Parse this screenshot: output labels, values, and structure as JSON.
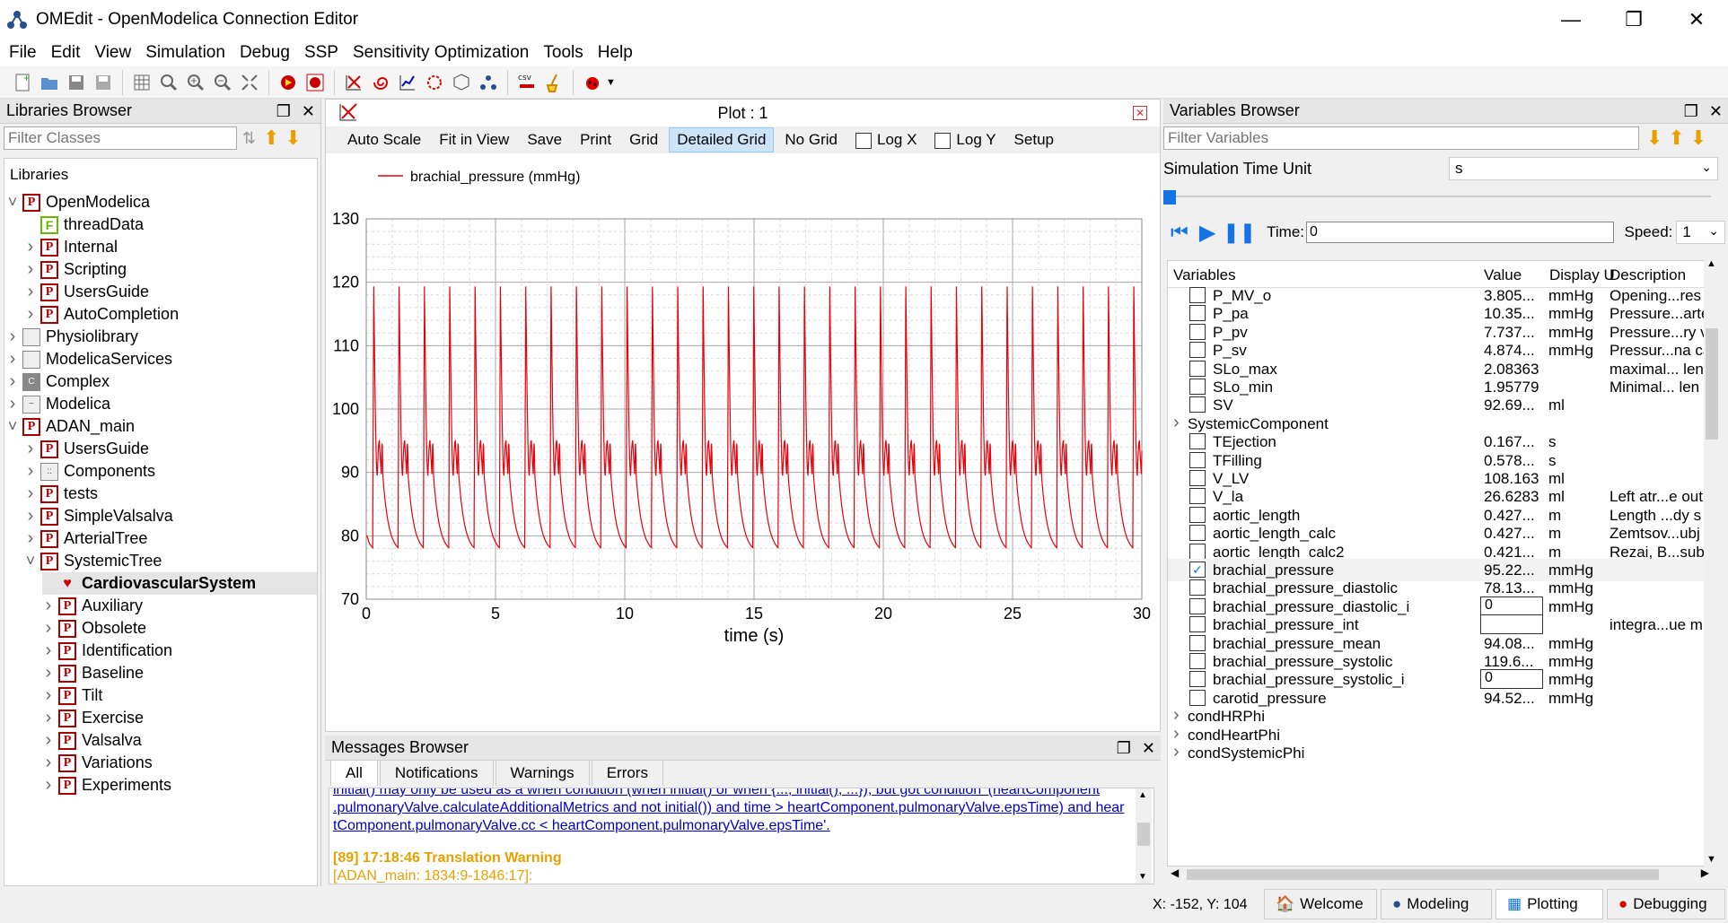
{
  "window": {
    "title": "OMEdit - OpenModelica Connection Editor"
  },
  "menu": [
    "File",
    "Edit",
    "View",
    "Simulation",
    "Debug",
    "SSP",
    "Sensitivity Optimization",
    "Tools",
    "Help"
  ],
  "libraries": {
    "title": "Libraries Browser",
    "filter_placeholder": "Filter Classes",
    "tree_title": "Libraries",
    "items": [
      {
        "label": "OpenModelica",
        "icon": "P",
        "level": 0,
        "expanded": true
      },
      {
        "label": "threadData",
        "icon": "F",
        "level": 1,
        "expanded": null
      },
      {
        "label": "Internal",
        "icon": "P",
        "level": 1,
        "expanded": false
      },
      {
        "label": "Scripting",
        "icon": "P",
        "level": 1,
        "expanded": false
      },
      {
        "label": "UsersGuide",
        "icon": "P",
        "level": 1,
        "expanded": false
      },
      {
        "label": "AutoCompletion",
        "icon": "P",
        "level": 1,
        "expanded": false
      },
      {
        "label": "Physiolibrary",
        "icon": "plain",
        "level": 0,
        "expanded": false
      },
      {
        "label": "ModelicaServices",
        "icon": "plain",
        "level": 0,
        "expanded": false
      },
      {
        "label": "Complex",
        "icon": "C",
        "level": 0,
        "expanded": false
      },
      {
        "label": "Modelica",
        "icon": "M",
        "level": 0,
        "expanded": false
      },
      {
        "label": "ADAN_main",
        "icon": "P",
        "level": 0,
        "expanded": true
      },
      {
        "label": "UsersGuide",
        "icon": "P",
        "level": 1,
        "expanded": false
      },
      {
        "label": "Components",
        "icon": "comp",
        "level": 1,
        "expanded": false
      },
      {
        "label": "tests",
        "icon": "P",
        "level": 1,
        "expanded": false
      },
      {
        "label": "SimpleValsalva",
        "icon": "P",
        "level": 1,
        "expanded": false
      },
      {
        "label": "ArterialTree",
        "icon": "P",
        "level": 1,
        "expanded": false
      },
      {
        "label": "SystemicTree",
        "icon": "P",
        "level": 1,
        "expanded": true
      },
      {
        "label": "CardiovascularSystem",
        "icon": "model",
        "level": 2,
        "expanded": null,
        "selected": true
      },
      {
        "label": "Auxiliary",
        "icon": "P",
        "level": 2,
        "expanded": false
      },
      {
        "label": "Obsolete",
        "icon": "P",
        "level": 2,
        "expanded": false
      },
      {
        "label": "Identification",
        "icon": "P",
        "level": 2,
        "expanded": false
      },
      {
        "label": "Baseline",
        "icon": "P",
        "level": 2,
        "expanded": false
      },
      {
        "label": "Tilt",
        "icon": "P",
        "level": 2,
        "expanded": false
      },
      {
        "label": "Exercise",
        "icon": "P",
        "level": 2,
        "expanded": false
      },
      {
        "label": "Valsalva",
        "icon": "P",
        "level": 2,
        "expanded": false
      },
      {
        "label": "Variations",
        "icon": "P",
        "level": 2,
        "expanded": false
      },
      {
        "label": "Experiments",
        "icon": "P",
        "level": 2,
        "expanded": false
      }
    ]
  },
  "plot": {
    "title": "Plot : 1",
    "buttons": [
      "Auto Scale",
      "Fit in View",
      "Save",
      "Print",
      "Grid",
      "Detailed Grid",
      "No Grid"
    ],
    "active_button": "Detailed Grid",
    "log_x": "Log X",
    "log_y": "Log Y",
    "setup": "Setup"
  },
  "chart_data": {
    "type": "line",
    "legend": "brachial_pressure (mmHg)",
    "xlabel": "time (s)",
    "ylabel": "",
    "xlim": [
      0,
      30
    ],
    "ylim": [
      70,
      130
    ],
    "x_ticks": [
      "0",
      "5",
      "10",
      "15",
      "20",
      "25",
      "30"
    ],
    "y_ticks": [
      "70",
      "80",
      "90",
      "100",
      "110",
      "120",
      "130"
    ],
    "series": [
      {
        "name": "brachial_pressure (mmHg)",
        "color": "#e8000b",
        "description": "periodic pulse wave, ~1.05 Hz",
        "period": 0.98,
        "peak": 119.6,
        "trough": 78.13,
        "dicrotic_notch": 89.5,
        "dicrotic_peak": 95.0,
        "start_value": 80.0
      }
    ],
    "grid": "detailed"
  },
  "messages": {
    "title": "Messages Browser",
    "tabs": [
      "All",
      "Notifications",
      "Warnings",
      "Errors"
    ],
    "lines": [
      "initial() may only be used as a when condition (when initial() or when {..., initial(), ...}), but got condition '(heartComponent",
      ".pulmonaryValve.calculateAdditionalMetrics and not initial()) and time > heartComponent.pulmonaryValve.epsTime) and hear",
      "tComponent.pulmonaryValve.cc < heartComponent.pulmonaryValve.epsTime'."
    ],
    "warning_title": "[89] 17:18:46 Translation Warning",
    "warning_sub": "[ADAN_main: 1834:9-1846:17]:"
  },
  "variables": {
    "title": "Variables Browser",
    "filter_placeholder": "Filter Variables",
    "sim_time_unit_label": "Simulation Time Unit",
    "sim_time_unit": "s",
    "time_label": "Time:",
    "time_value": "0",
    "speed_label": "Speed:",
    "speed_value": "1",
    "columns": [
      "Variables",
      "Value",
      "Display U",
      "Description"
    ],
    "rows": [
      {
        "name": "P_MV_o",
        "value": "3.805...",
        "unit": "mmHg",
        "desc": "Opening...res",
        "checked": false,
        "group": false
      },
      {
        "name": "P_pa",
        "value": "10.35...",
        "unit": "mmHg",
        "desc": "Pressure...arte",
        "checked": false,
        "group": false
      },
      {
        "name": "P_pv",
        "value": "7.737...",
        "unit": "mmHg",
        "desc": "Pressure...ry v",
        "checked": false,
        "group": false
      },
      {
        "name": "P_sv",
        "value": "4.874...",
        "unit": "mmHg",
        "desc": "Pressur...na ca",
        "checked": false,
        "group": false
      },
      {
        "name": "SLo_max",
        "value": "2.08363",
        "unit": "",
        "desc": "maximal... len",
        "checked": false,
        "group": false
      },
      {
        "name": "SLo_min",
        "value": "1.95779",
        "unit": "",
        "desc": "Minimal... len",
        "checked": false,
        "group": false
      },
      {
        "name": "SV",
        "value": "92.69...",
        "unit": "ml",
        "desc": "",
        "checked": false,
        "group": false
      },
      {
        "name": "SystemicComponent",
        "value": "",
        "unit": "",
        "desc": "",
        "checked": false,
        "group": true
      },
      {
        "name": "TEjection",
        "value": "0.167...",
        "unit": "s",
        "desc": "",
        "checked": false,
        "group": false
      },
      {
        "name": "TFilling",
        "value": "0.578...",
        "unit": "s",
        "desc": "",
        "checked": false,
        "group": false
      },
      {
        "name": "V_LV",
        "value": "108.163",
        "unit": "ml",
        "desc": "",
        "checked": false,
        "group": false
      },
      {
        "name": "V_la",
        "value": "26.6283",
        "unit": "ml",
        "desc": "Left atr...e out",
        "checked": false,
        "group": false
      },
      {
        "name": "aortic_length",
        "value": "0.427...",
        "unit": "m",
        "desc": "Length ...dy s",
        "checked": false,
        "group": false
      },
      {
        "name": "aortic_length_calc",
        "value": "0.427...",
        "unit": "m",
        "desc": "Zemtsov...ubj",
        "checked": false,
        "group": false
      },
      {
        "name": "aortic_length_calc2",
        "value": "0.421...",
        "unit": "m",
        "desc": "Rezai, B...subj",
        "checked": false,
        "group": false
      },
      {
        "name": "brachial_pressure",
        "value": "95.22...",
        "unit": "mmHg",
        "desc": "",
        "checked": true,
        "group": false
      },
      {
        "name": "brachial_pressure_diastolic",
        "value": "78.13...",
        "unit": "mmHg",
        "desc": "",
        "checked": false,
        "group": false
      },
      {
        "name": "brachial_pressure_diastolic_i",
        "value": "0",
        "unit": "mmHg",
        "desc": "",
        "checked": false,
        "group": false,
        "input": true
      },
      {
        "name": "brachial_pressure_int",
        "value": "",
        "unit": "",
        "desc": "integra...ue m",
        "checked": false,
        "group": false,
        "input": true
      },
      {
        "name": "brachial_pressure_mean",
        "value": "94.08...",
        "unit": "mmHg",
        "desc": "",
        "checked": false,
        "group": false
      },
      {
        "name": "brachial_pressure_systolic",
        "value": "119.6...",
        "unit": "mmHg",
        "desc": "",
        "checked": false,
        "group": false
      },
      {
        "name": "brachial_pressure_systolic_i",
        "value": "0",
        "unit": "mmHg",
        "desc": "",
        "checked": false,
        "group": false,
        "input": true
      },
      {
        "name": "carotid_pressure",
        "value": "94.52...",
        "unit": "mmHg",
        "desc": "",
        "checked": false,
        "group": false
      },
      {
        "name": "condHRPhi",
        "value": "",
        "unit": "",
        "desc": "",
        "checked": false,
        "group": true
      },
      {
        "name": "condHeartPhi",
        "value": "",
        "unit": "",
        "desc": "",
        "checked": false,
        "group": true
      },
      {
        "name": "condSystemicPhi",
        "value": "",
        "unit": "",
        "desc": "",
        "checked": false,
        "group": true
      }
    ]
  },
  "status": {
    "coords": "X: -152, Y: 104",
    "perspectives": [
      "Welcome",
      "Modeling",
      "Plotting",
      "Debugging"
    ],
    "active_perspective": "Plotting"
  }
}
